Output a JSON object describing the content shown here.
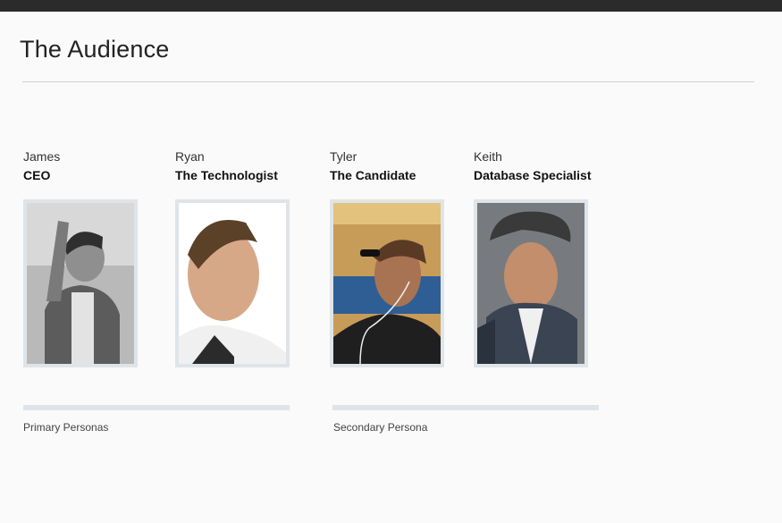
{
  "page": {
    "title": "The Audience"
  },
  "personas": [
    {
      "name": "James",
      "role": "CEO",
      "photo_icon": "person-photo-james"
    },
    {
      "name": "Ryan",
      "role": "The Technologist",
      "photo_icon": "person-photo-ryan"
    },
    {
      "name": "Tyler",
      "role": "The Candidate",
      "photo_icon": "person-photo-tyler"
    },
    {
      "name": "Keith",
      "role": "Database Specialist",
      "photo_icon": "person-photo-keith"
    }
  ],
  "groups": [
    {
      "label": "Primary Personas"
    },
    {
      "label": "Secondary Persona"
    }
  ],
  "colors": {
    "topbar": "#2b2b2b",
    "frame": "#dfe4e8",
    "rule": "#cfcfcf"
  }
}
